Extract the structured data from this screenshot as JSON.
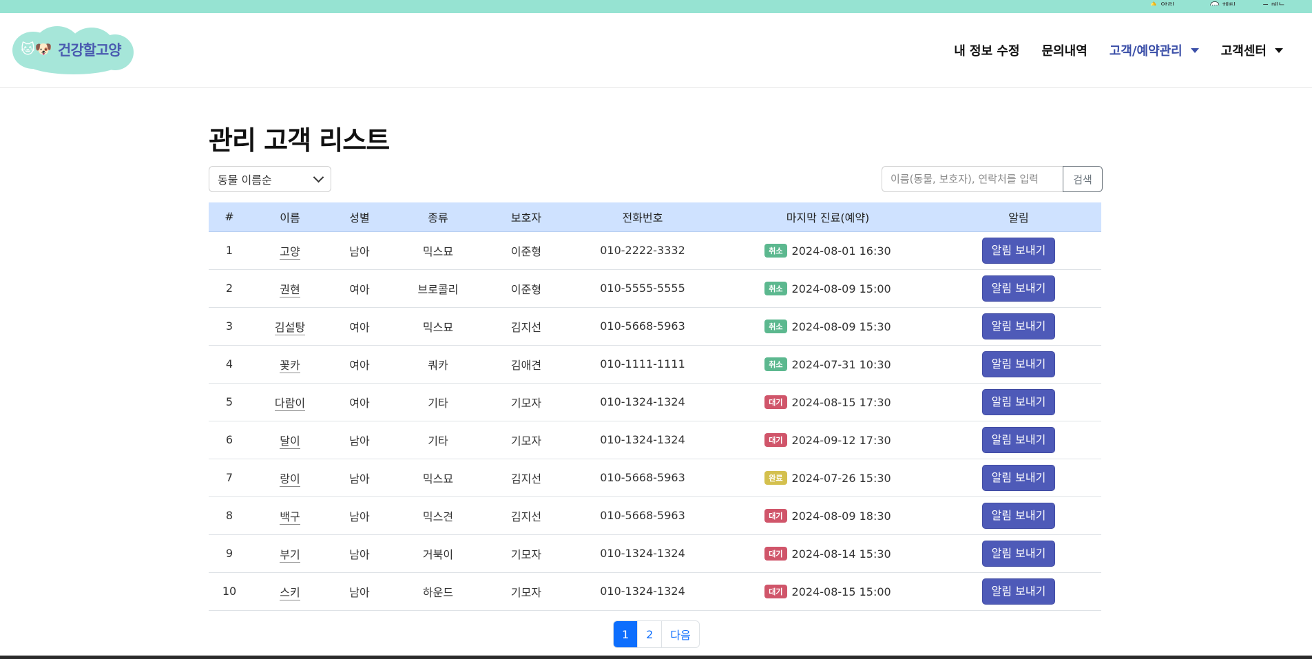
{
  "topbar": {
    "mini_items": [
      "🔔 알림",
      "💬 채팅",
      "≡ 메뉴"
    ]
  },
  "logo": {
    "text": "건강할고양"
  },
  "nav": [
    {
      "label": "내 정보 수정",
      "dropdown": false,
      "active": false
    },
    {
      "label": "문의내역",
      "dropdown": false,
      "active": false
    },
    {
      "label": "고객/예약관리",
      "dropdown": true,
      "active": true
    },
    {
      "label": "고객센터",
      "dropdown": true,
      "active": false
    }
  ],
  "page": {
    "title": "관리 고객 리스트"
  },
  "sort": {
    "selected": "동물 이름순"
  },
  "search": {
    "placeholder": "이름(동물, 보호자), 연락처를 입력",
    "button": "검색"
  },
  "table": {
    "headers": [
      "#",
      "이름",
      "성별",
      "종류",
      "보호자",
      "전화번호",
      "마지막 진료(예약)",
      "알림"
    ],
    "notify_label": "알림 보내기",
    "status_colors": {
      "취소": "#5cb88f",
      "대기": "#d0556a",
      "완료": "#d4c04e"
    },
    "rows": [
      {
        "no": "1",
        "name": "고양",
        "gender": "남아",
        "kind": "믹스묘",
        "owner": "이준형",
        "phone": "010-2222-3332",
        "status": "취소",
        "date": "2024-08-01 16:30"
      },
      {
        "no": "2",
        "name": "권현",
        "gender": "여아",
        "kind": "브로콜리",
        "owner": "이준형",
        "phone": "010-5555-5555",
        "status": "취소",
        "date": "2024-08-09 15:00"
      },
      {
        "no": "3",
        "name": "김설탕",
        "gender": "여아",
        "kind": "믹스묘",
        "owner": "김지선",
        "phone": "010-5668-5963",
        "status": "취소",
        "date": "2024-08-09 15:30"
      },
      {
        "no": "4",
        "name": "꽃카",
        "gender": "여아",
        "kind": "쿼카",
        "owner": "김애견",
        "phone": "010-1111-1111",
        "status": "취소",
        "date": "2024-07-31 10:30"
      },
      {
        "no": "5",
        "name": "다람이",
        "gender": "여아",
        "kind": "기타",
        "owner": "기모자",
        "phone": "010-1324-1324",
        "status": "대기",
        "date": "2024-08-15 17:30"
      },
      {
        "no": "6",
        "name": "달이",
        "gender": "남아",
        "kind": "기타",
        "owner": "기모자",
        "phone": "010-1324-1324",
        "status": "대기",
        "date": "2024-09-12 17:30"
      },
      {
        "no": "7",
        "name": "랑이",
        "gender": "남아",
        "kind": "믹스묘",
        "owner": "김지선",
        "phone": "010-5668-5963",
        "status": "완료",
        "date": "2024-07-26 15:30"
      },
      {
        "no": "8",
        "name": "백구",
        "gender": "남아",
        "kind": "믹스견",
        "owner": "김지선",
        "phone": "010-5668-5963",
        "status": "대기",
        "date": "2024-08-09 18:30"
      },
      {
        "no": "9",
        "name": "부기",
        "gender": "남아",
        "kind": "거북이",
        "owner": "기모자",
        "phone": "010-1324-1324",
        "status": "대기",
        "date": "2024-08-14 15:30"
      },
      {
        "no": "10",
        "name": "스키",
        "gender": "남아",
        "kind": "하운드",
        "owner": "기모자",
        "phone": "010-1324-1324",
        "status": "대기",
        "date": "2024-08-15 15:00"
      }
    ]
  },
  "pagination": {
    "pages": [
      "1",
      "2"
    ],
    "active": "1",
    "next": "다음"
  }
}
